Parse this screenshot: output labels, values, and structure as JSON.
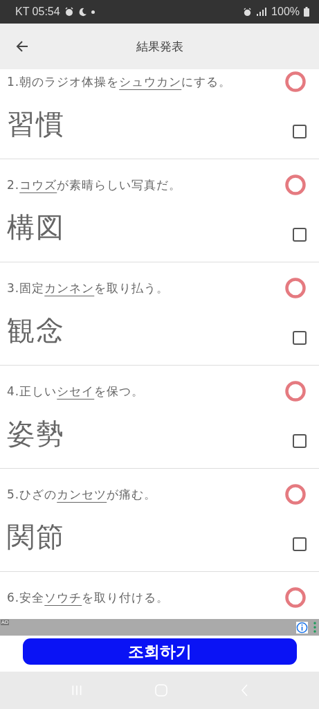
{
  "status_bar": {
    "carrier": "KT",
    "time": "05:54",
    "battery": "100%"
  },
  "header": {
    "title": "結果発表"
  },
  "questions": [
    {
      "number": "1.",
      "before": "朝のラジオ体操を",
      "underlined": "シュウカン",
      "after": "にする。",
      "answer": "習慣",
      "correct": true,
      "checked": false
    },
    {
      "number": "2.",
      "underlined": "コウズ",
      "after": "が素晴らしい写真だ。",
      "answer": "構図",
      "correct": true,
      "checked": false
    },
    {
      "number": "3.",
      "before": "固定",
      "underlined": "カンネン",
      "after": "を取り払う。",
      "answer": "観念",
      "correct": true,
      "checked": false
    },
    {
      "number": "4.",
      "before": "正しい",
      "underlined": "シセイ",
      "after": "を保つ。",
      "answer": "姿勢",
      "correct": true,
      "checked": false
    },
    {
      "number": "5.",
      "before": "ひざの",
      "underlined": "カンセツ",
      "after": "が痛む。",
      "answer": "関節",
      "correct": true,
      "checked": false
    },
    {
      "number": "6.",
      "before": "安全",
      "underlined": "ソウチ",
      "after": "を取り付ける。",
      "correct": true
    }
  ],
  "ad": {
    "badge": "AD",
    "button": "조회하기"
  }
}
